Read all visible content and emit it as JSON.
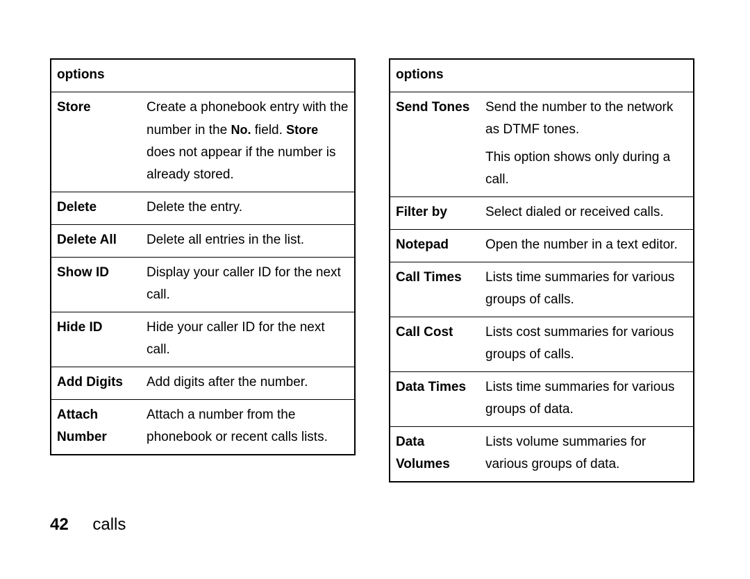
{
  "footer": {
    "page_number": "42",
    "section": "calls"
  },
  "left": {
    "header": "options",
    "rows": [
      {
        "label": "Store",
        "desc_pre": "Create a phonebook entry with the number in the ",
        "desc_inline1": "No.",
        "desc_mid": " field. ",
        "desc_inline2": "Store",
        "desc_post": " does not appear if the number is already stored."
      },
      {
        "label": "Delete",
        "desc": "Delete the entry."
      },
      {
        "label": "Delete All",
        "desc": "Delete all entries in the list."
      },
      {
        "label": "Show ID",
        "desc": "Display your caller ID for the next call."
      },
      {
        "label": "Hide ID",
        "desc": "Hide your caller ID for the next call."
      },
      {
        "label": "Add Digits",
        "desc": "Add digits after the number."
      },
      {
        "label": "Attach Number",
        "desc": "Attach a number from the phonebook or recent calls lists."
      }
    ]
  },
  "right": {
    "header": "options",
    "rows": [
      {
        "label": "Send Tones",
        "desc": "Send the number to the network as DTMF tones.",
        "desc2": "This option shows only during a call."
      },
      {
        "label": "Filter by",
        "desc": "Select dialed or received calls."
      },
      {
        "label": "Notepad",
        "desc": "Open the number in a text editor."
      },
      {
        "label": "Call Times",
        "desc": "Lists time summaries for various groups of calls."
      },
      {
        "label": "Call Cost",
        "desc": "Lists cost summaries for various groups of calls."
      },
      {
        "label": "Data Times",
        "desc": "Lists time summaries for various groups of data."
      },
      {
        "label": "Data Volumes",
        "desc": "Lists volume summaries for various groups of data."
      }
    ]
  }
}
